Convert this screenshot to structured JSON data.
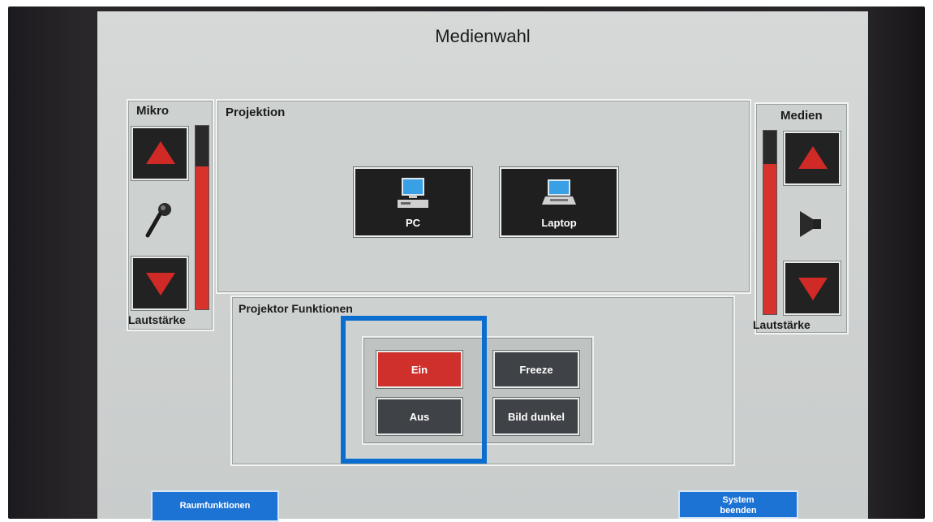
{
  "screen": {
    "title": "Medienwahl"
  },
  "mikro": {
    "label": "Mikro",
    "volume_label": "Lautstärke",
    "level": 0.78,
    "up_icon": "triangle-up-icon",
    "down_icon": "triangle-down-icon",
    "icon": "microphone-icon"
  },
  "medien": {
    "label": "Medien",
    "volume_label": "Lautstärke",
    "level": 0.82,
    "icon": "speaker-icon"
  },
  "projektion": {
    "label": "Projektion",
    "sources": [
      {
        "label": "PC",
        "icon": "desktop-pc-icon"
      },
      {
        "label": "Laptop",
        "icon": "laptop-icon"
      }
    ]
  },
  "projektor_funktionen": {
    "label": "Projektor Funktionen",
    "buttons": {
      "ein": "Ein",
      "aus": "Aus",
      "freeze": "Freeze",
      "bild_dunkel": "Bild dunkel"
    }
  },
  "bottom": {
    "raumfunktionen": "Raumfunktionen",
    "system_beenden_line1": "System",
    "system_beenden_line2": "beenden"
  },
  "colors": {
    "active_red": "#d0302b",
    "button_dark": "#3f4246",
    "highlight_blue": "#0a6ed1",
    "bottom_blue": "#1d73d4"
  }
}
